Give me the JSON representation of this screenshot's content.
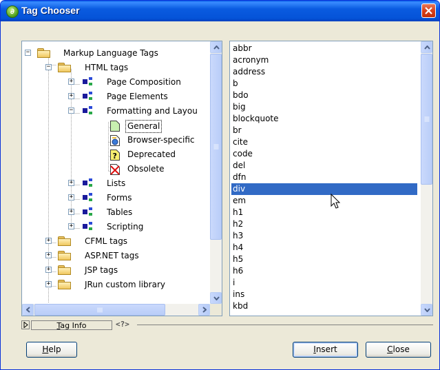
{
  "window": {
    "title": "Tag Chooser",
    "app_icon_glyph": "∂"
  },
  "tree": {
    "items": [
      {
        "label": "Markup Language Tags",
        "toggle": "−",
        "icon": "folder-open-icon"
      },
      {
        "label": "HTML tags",
        "toggle": "−",
        "icon": "folder-open-icon"
      },
      {
        "label": "Page Composition",
        "toggle": "+",
        "icon": "tag-group-icon"
      },
      {
        "label": "Page Elements",
        "toggle": "+",
        "icon": "tag-group-icon"
      },
      {
        "label": "Formatting and Layou",
        "toggle": "−",
        "icon": "tag-group-icon"
      },
      {
        "label": "General",
        "icon": "document-icon"
      },
      {
        "label": "Browser-specific",
        "icon": "browser-doc-icon"
      },
      {
        "label": "Deprecated",
        "icon": "deprecated-doc-icon"
      },
      {
        "label": "Obsolete",
        "icon": "obsolete-doc-icon"
      },
      {
        "label": "Lists",
        "toggle": "+",
        "icon": "tag-group-icon"
      },
      {
        "label": "Forms",
        "toggle": "+",
        "icon": "tag-group-icon"
      },
      {
        "label": "Tables",
        "toggle": "+",
        "icon": "tag-group-icon"
      },
      {
        "label": "Scripting",
        "toggle": "+",
        "icon": "tag-group-icon"
      },
      {
        "label": "CFML tags",
        "toggle": "+",
        "icon": "folder-icon"
      },
      {
        "label": "ASP.NET tags",
        "toggle": "+",
        "icon": "folder-icon"
      },
      {
        "label": "JSP tags",
        "toggle": "+",
        "icon": "folder-icon"
      },
      {
        "label": "JRun custom library",
        "toggle": "+",
        "icon": "folder-icon"
      }
    ],
    "selected": "General"
  },
  "tag_list": {
    "items": [
      "abbr",
      "acronym",
      "address",
      "b",
      "bdo",
      "big",
      "blockquote",
      "br",
      "cite",
      "code",
      "del",
      "dfn",
      "div",
      "em",
      "h1",
      "h2",
      "h3",
      "h4",
      "h5",
      "h6",
      "i",
      "ins",
      "kbd"
    ],
    "selected": "div"
  },
  "tag_info": {
    "tab_label": "Tag Info",
    "code_glyph": "<?>"
  },
  "buttons": {
    "help": "Help",
    "insert": "Insert",
    "close": "Close"
  },
  "colors": {
    "selection": "#316ac5",
    "title_bar": "#0a5be0",
    "close_button": "#d8401a"
  }
}
